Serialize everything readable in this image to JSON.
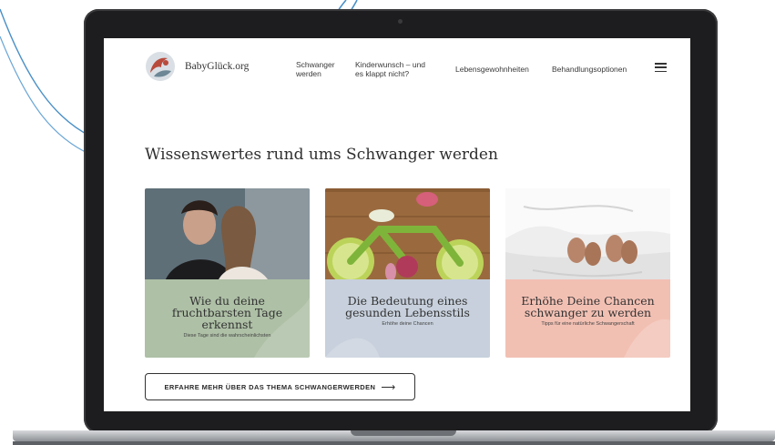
{
  "site": {
    "logo_text": "BabyGlück.org"
  },
  "nav": {
    "items": [
      {
        "line1": "Schwanger",
        "line2": "werden"
      },
      {
        "line1": "Kinderwunsch – und",
        "line2": "es klappt nicht?"
      },
      {
        "line1": "Lebensgewohnheiten",
        "line2": ""
      },
      {
        "line1": "Behandlungsoptionen",
        "line2": ""
      }
    ],
    "menu_icon": "hamburger-menu-icon"
  },
  "main": {
    "heading": "Wissenswertes rund ums Schwanger werden",
    "cards": [
      {
        "title": "Wie du deine fruchtbarsten Tage erkennst",
        "subtitle": "Diese Tage sind die wahrscheinlichsten",
        "color": "#aec0a6"
      },
      {
        "title": "Die Bedeutung eines gesunden Lebensstils",
        "subtitle": "Erhöhe deine Chancen",
        "color": "#c7d0dc"
      },
      {
        "title": "Erhöhe Deine Chancen schwanger zu werden",
        "subtitle": "Tipps für eine natürliche Schwangerschaft",
        "color": "#f2c0b3"
      }
    ],
    "cta_label": "ERFAHRE MEHR ÜBER DAS THEMA SCHWANGERWERDEN",
    "cta_arrow": "⟶"
  },
  "colors": {
    "laptop_bezel": "#1d1d1f",
    "arc_blue": "#4a90c8"
  }
}
